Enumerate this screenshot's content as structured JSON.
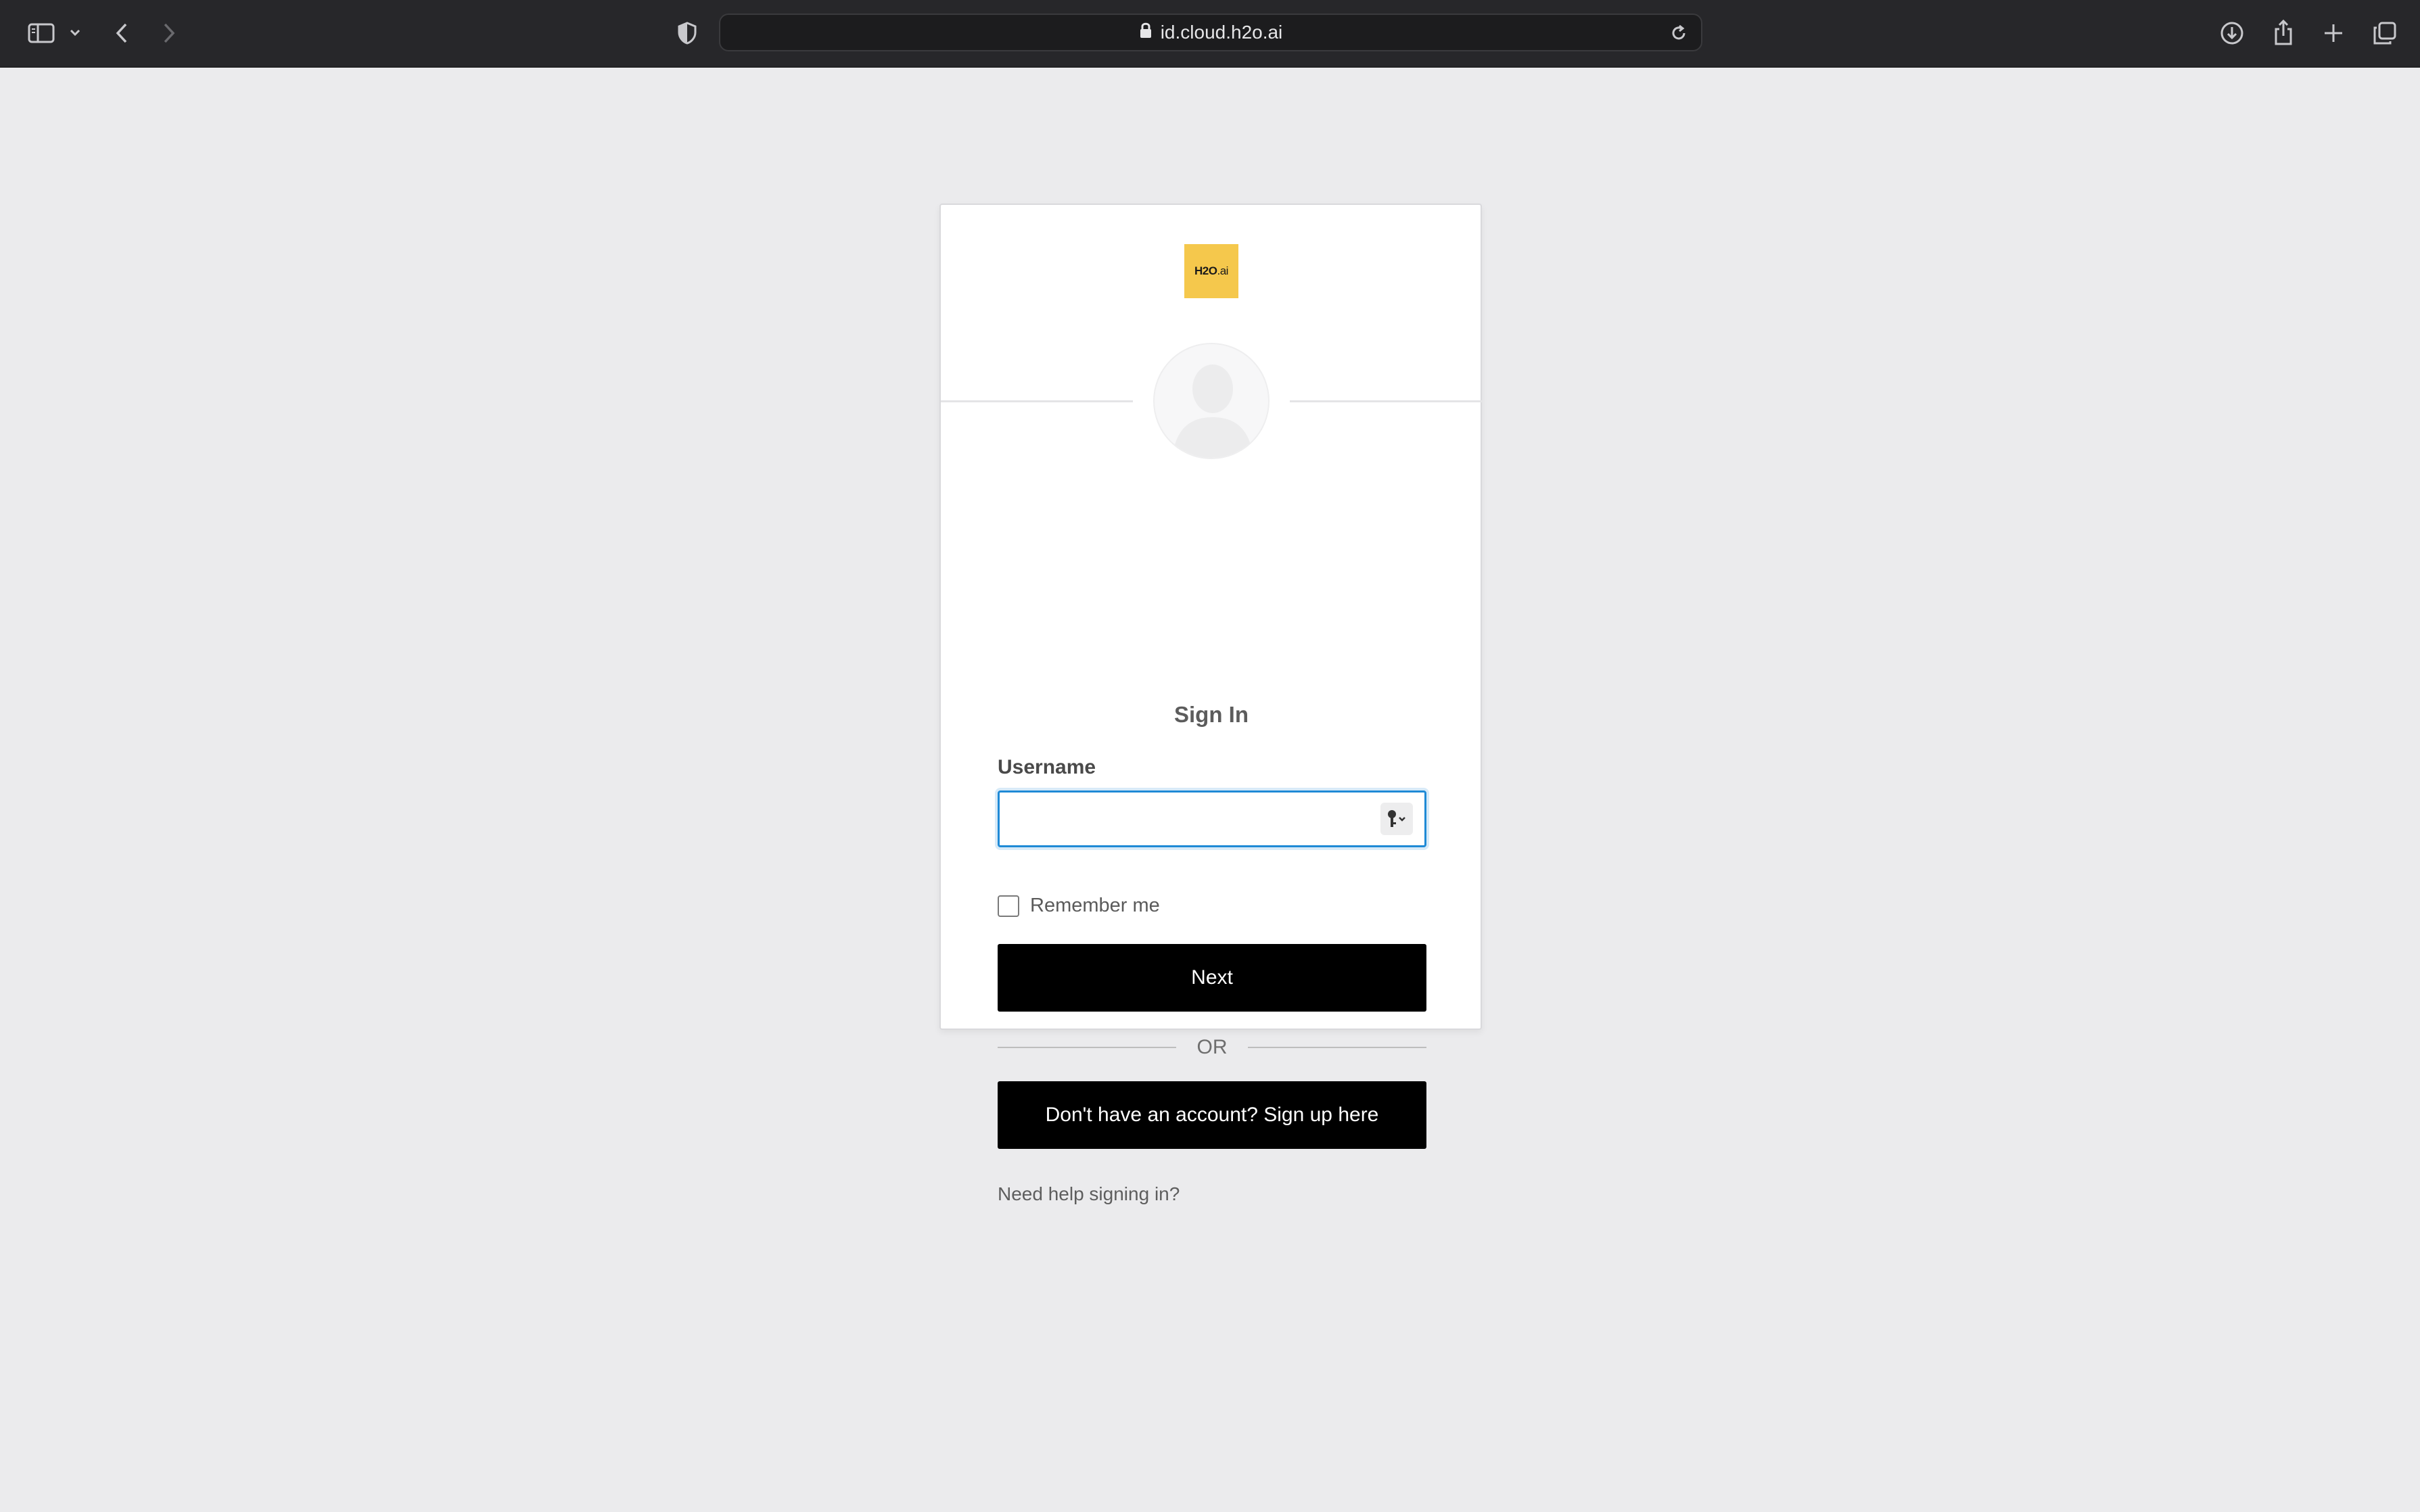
{
  "browser": {
    "url": "id.cloud.h2o.ai",
    "icons": {
      "sidebar": "sidebar-icon",
      "sidebar_menu": "chevron-down-icon",
      "back": "back-arrow-icon",
      "forward": "forward-arrow-icon",
      "privacy": "shield-icon",
      "lock": "lock-icon",
      "reload": "reload-icon",
      "downloads": "download-icon",
      "share": "share-icon",
      "new_tab": "plus-icon",
      "tab_overview": "tabs-icon"
    }
  },
  "login": {
    "logo_main": "H2O",
    "logo_suffix": ".ai",
    "title": "Sign In",
    "username_label": "Username",
    "username_value": "",
    "remember_label": "Remember me",
    "next_label": "Next",
    "or_label": "OR",
    "signup_label": "Don't have an account? Sign up here",
    "help_label": "Need help signing in?",
    "colors": {
      "accent_focus": "#1f8ad6",
      "logo_bg": "#f5c84c",
      "button_bg": "#000000",
      "page_bg": "#ebebed"
    }
  }
}
